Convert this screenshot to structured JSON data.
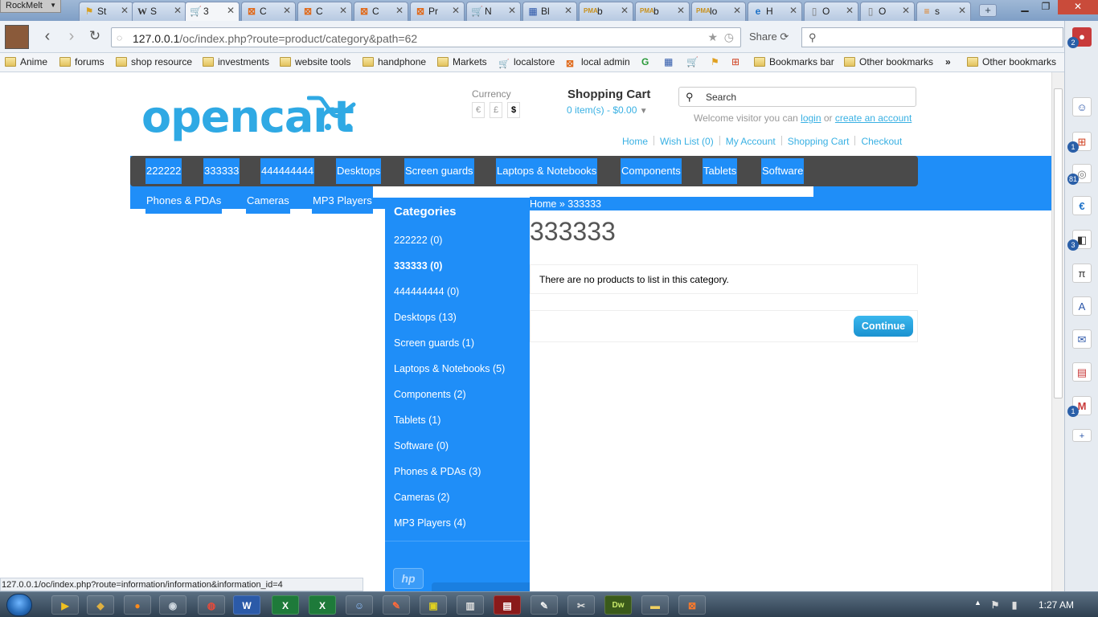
{
  "browser": {
    "app_menu": "RockMelt",
    "tabs": [
      {
        "label": "St",
        "icon": "flag"
      },
      {
        "label": "S",
        "icon": "W"
      },
      {
        "label": "3",
        "icon": "cart",
        "active": true
      },
      {
        "label": "C",
        "icon": "xampp"
      },
      {
        "label": "C",
        "icon": "xampp"
      },
      {
        "label": "C",
        "icon": "xampp"
      },
      {
        "label": "Pr",
        "icon": "xampp"
      },
      {
        "label": "N",
        "icon": "cart"
      },
      {
        "label": "Bl",
        "icon": "grid"
      },
      {
        "label": "b",
        "icon": "pma"
      },
      {
        "label": "b",
        "icon": "pma"
      },
      {
        "label": "lo",
        "icon": "pma"
      },
      {
        "label": "H",
        "icon": "ie"
      },
      {
        "label": "O",
        "icon": "page"
      },
      {
        "label": "O",
        "icon": "page"
      },
      {
        "label": "s",
        "icon": "stack"
      }
    ],
    "url_host": "127.0.0.1",
    "url_rest": "/oc/index.php?route=product/category&path=62",
    "share_label": "Share",
    "search_placeholder": "",
    "status_url": "127.0.0.1/oc/index.php?route=information/information&information_id=4"
  },
  "bookmarks": [
    {
      "label": "Anime",
      "icon": "folder"
    },
    {
      "label": "forums",
      "icon": "folder"
    },
    {
      "label": "shop resource",
      "icon": "folder"
    },
    {
      "label": "investments",
      "icon": "folder"
    },
    {
      "label": "website tools",
      "icon": "folder"
    },
    {
      "label": "handphone",
      "icon": "folder"
    },
    {
      "label": "Markets",
      "icon": "folder"
    },
    {
      "label": "localstore",
      "icon": "cart"
    },
    {
      "label": "local admin",
      "icon": "xampp"
    },
    {
      "label": "Bookmarks bar",
      "icon": "folder"
    },
    {
      "label": "Other bookmarks",
      "icon": "folder"
    },
    {
      "label": "Other bookmarks",
      "icon": "folder"
    }
  ],
  "edge_badges": [
    "2",
    "1",
    "81",
    "3",
    "1"
  ],
  "store": {
    "logo": "opencart",
    "currency_label": "Currency",
    "currencies": [
      "€",
      "£",
      "$"
    ],
    "cart_title": "Shopping Cart",
    "cart_total": "0 item(s) - $0.00",
    "search_placeholder": "Search",
    "welcome_prefix": "Welcome visitor you can",
    "welcome_login": "login",
    "welcome_or": "or",
    "welcome_create": "create an account",
    "top_links": [
      "Home",
      "Wish List (0)",
      "My Account",
      "Shopping Cart",
      "Checkout"
    ],
    "menu": [
      "222222",
      "333333",
      "444444444",
      "Desktops",
      "Screen guards",
      "Laptops & Notebooks",
      "Components",
      "Tablets",
      "Software"
    ],
    "menu_row2": [
      "Phones & PDAs",
      "Cameras",
      "MP3 Players"
    ],
    "categories_title": "Categories",
    "categories": [
      "222222 (0)",
      "333333 (0)",
      "444444444 (0)",
      "Desktops (13)",
      "Screen guards (1)",
      "Laptops & Notebooks (5)",
      "Components (2)",
      "Tablets (1)",
      "Software (0)",
      "Phones & PDAs (3)",
      "Cameras (2)",
      "MP3 Players (4)"
    ],
    "active_category_index": 1,
    "breadcrumb_home": "Home",
    "breadcrumb_sep": "»",
    "breadcrumb_current": "333333",
    "heading": "333333",
    "empty_text": "There are no products to list in this category.",
    "continue_label": "Continue",
    "brand_logo": "hp"
  },
  "taskbar": {
    "clock": "1:27 AM"
  },
  "colors": {
    "menu_blue": "#1f8ef8",
    "menu_dark": "#4a4a4a",
    "link": "#38b0e3"
  }
}
